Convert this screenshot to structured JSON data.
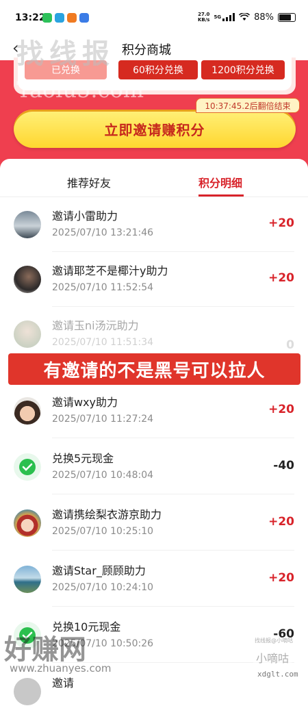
{
  "status_bar": {
    "time": "13:22",
    "net_speed_value": "27.0",
    "net_speed_unit": "KB/s",
    "network": "5G",
    "battery": "88%"
  },
  "header": {
    "title": "积分商城",
    "back_icon": "chevron-left-icon"
  },
  "exchange": {
    "buttons": [
      {
        "label": "已兑换",
        "state": "done"
      },
      {
        "label": "60积分兑换",
        "state": "active"
      },
      {
        "label": "1200积分兑换",
        "state": "active"
      }
    ]
  },
  "promo": {
    "timer": "10:37:45.2后翻倍结束",
    "invite_label": "立即邀请赚积分"
  },
  "tabs": [
    {
      "label": "推荐好友",
      "active": false
    },
    {
      "label": "积分明细",
      "active": true
    }
  ],
  "records": [
    {
      "title": "邀请小雷助力",
      "date": "2025/07/10 13:21:46",
      "points": "+20"
    },
    {
      "title": "邀请耶芝不是椰汁y助力",
      "date": "2025/07/10 11:52:54",
      "points": "+20"
    },
    {
      "title": "邀请玉ni汤沅助力",
      "date": "2025/07/10 11:51:34",
      "points": "0"
    },
    {
      "title": "邀请wxy助力",
      "date": "2025/07/10 11:27:24",
      "points": "+20"
    },
    {
      "title": "兑换5元现金",
      "date": "2025/07/10 10:48:04",
      "points": "-40"
    },
    {
      "title": "邀请携绘梨衣游京助力",
      "date": "2025/07/10 10:25:10",
      "points": "+20"
    },
    {
      "title": "邀请Star_顾顾助力",
      "date": "2025/07/10 10:24:10",
      "points": "+20"
    },
    {
      "title": "兑换10元现金",
      "date": "2025/07/10 10:50:26",
      "points": "-60"
    },
    {
      "title": "邀请",
      "date": "",
      "points": ""
    }
  ],
  "overlay_caption": "有邀请的不是黑号可以拉人",
  "watermarks": {
    "top": "找线报",
    "url": "Taolu5.com",
    "bottom_left": "好赚网",
    "bottom_left_url": "www.zhuanyes.com",
    "bottom_right": "小嘀咕",
    "bottom_right_small": "找线报@小嘀咕",
    "bottom_right_url": "xdglt.com"
  },
  "colors": {
    "brand_red": "#d8232a",
    "hero_bg": "#ef3f4f",
    "button_yellow": "#ffd62f",
    "positive": "#d8232a",
    "negative": "#222222",
    "zero": "#aaaaaa"
  }
}
